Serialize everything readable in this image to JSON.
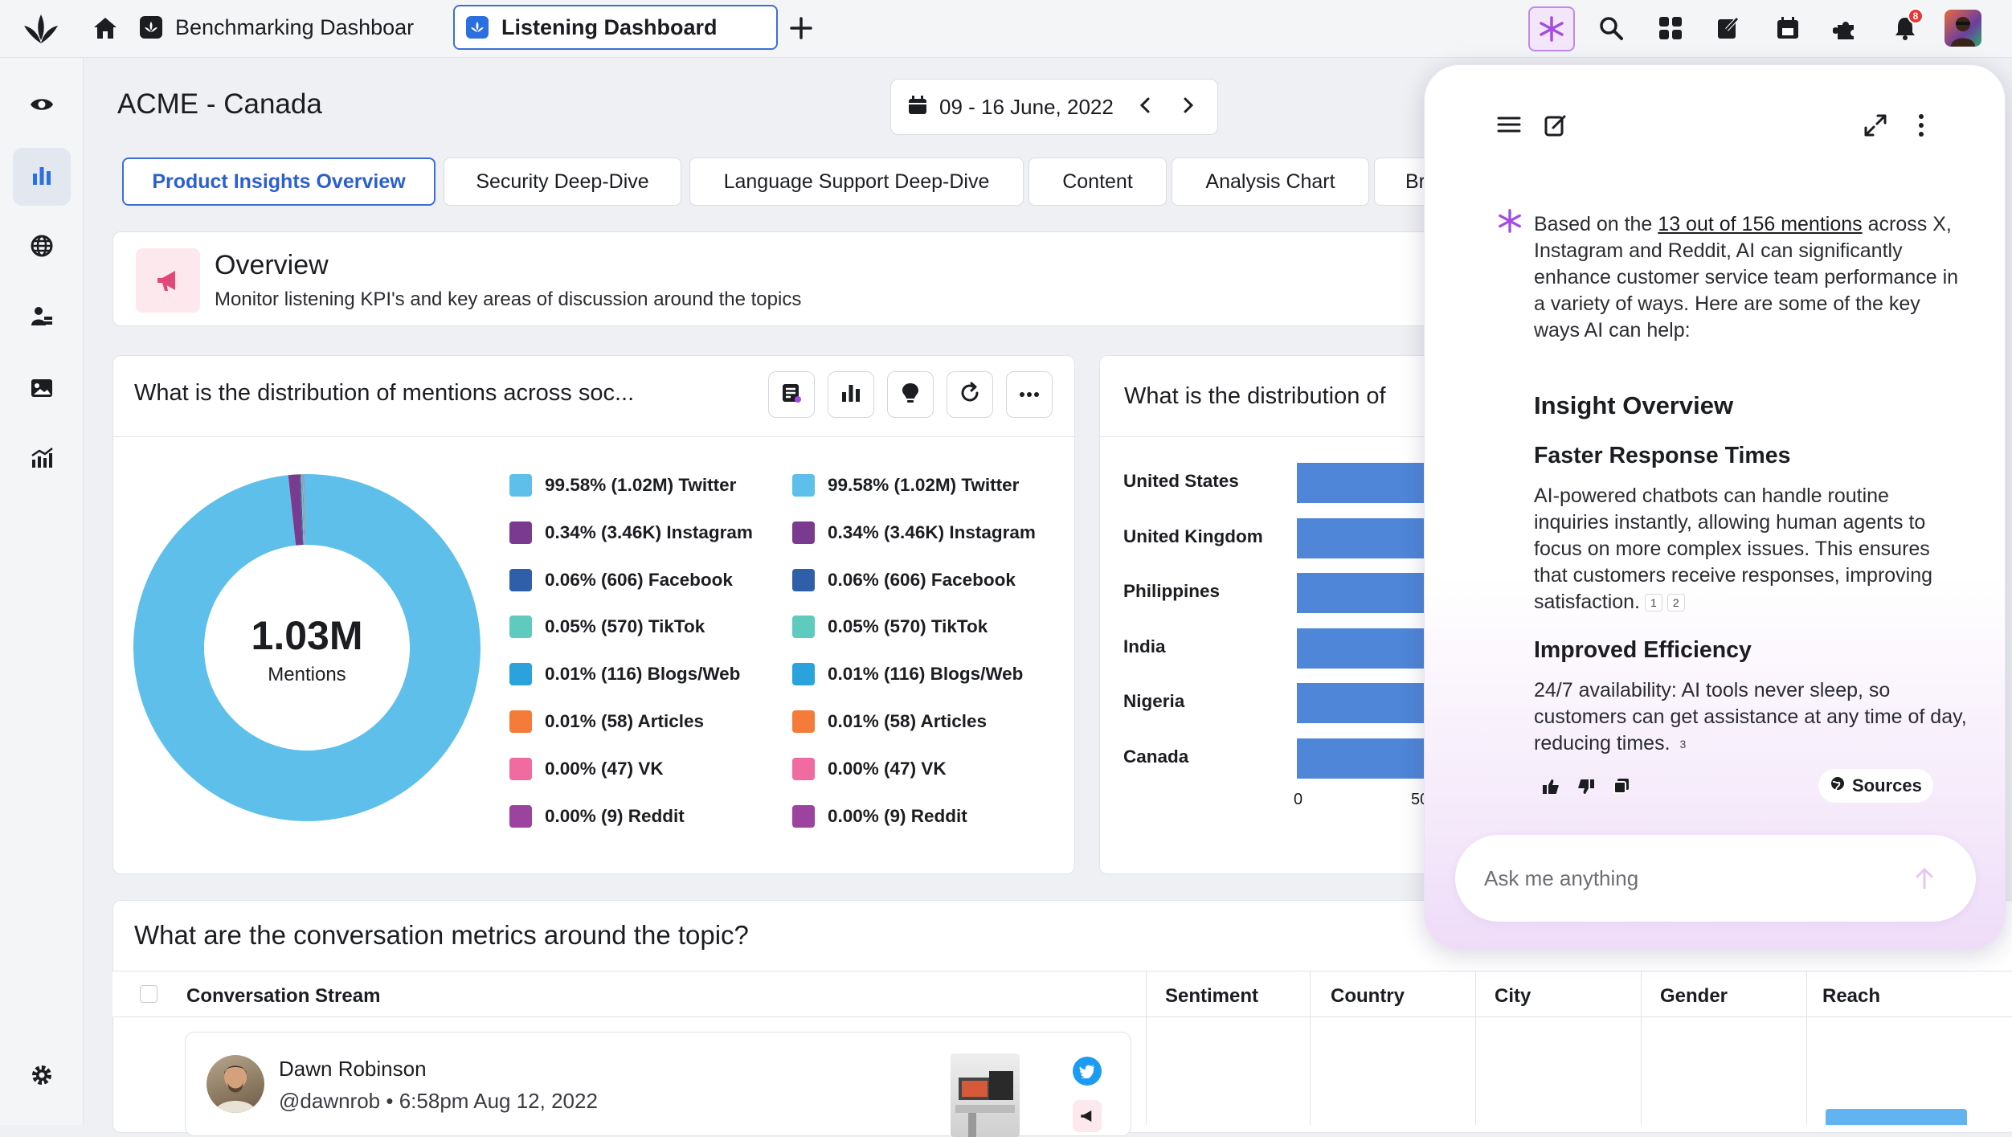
{
  "browser_tabs": [
    {
      "label": "Benchmarking Dashboar"
    },
    {
      "label": "Listening Dashboard"
    }
  ],
  "notification_count": "8",
  "page": {
    "title": "ACME - Canada",
    "date_range": "09 - 16 June, 2022"
  },
  "dashboard_tabs": [
    "Product Insights Overview",
    "Security Deep-Dive",
    "Language Support Deep-Dive",
    "Content",
    "Analysis Chart",
    "Br"
  ],
  "overview": {
    "title": "Overview",
    "subtitle": "Monitor listening KPI's and key areas of discussion around the topics"
  },
  "widget1": {
    "title": "What is the distribution of mentions across soc...",
    "center_value": "1.03M",
    "center_label": "Mentions"
  },
  "chart_data": [
    {
      "type": "pie",
      "categories": [
        "Twitter",
        "Instagram",
        "Facebook",
        "TikTok",
        "Blogs/Web",
        "Articles",
        "VK",
        "Reddit"
      ],
      "values": [
        99.58,
        0.34,
        0.06,
        0.05,
        0.01,
        0.01,
        0.0,
        0.0
      ],
      "counts": [
        "1.02M",
        "3.46K",
        "606",
        "570",
        "116",
        "58",
        "47",
        "9"
      ],
      "legend_labels": [
        "99.58% (1.02M) Twitter",
        "0.34% (3.46K) Instagram",
        "0.06% (606) Facebook",
        "0.05% (570) TikTok",
        "0.01% (116) Blogs/Web",
        "0.01% (58) Articles",
        "0.00% (47) VK",
        "0.00% (9) Reddit"
      ],
      "colors": [
        "#5ec0ea",
        "#7a3a8f",
        "#2f5fa8",
        "#5fcbbf",
        "#2aa3dc",
        "#f47b3a",
        "#f06ba0",
        "#9c43a0"
      ],
      "legend_placement": "right"
    },
    {
      "type": "bar",
      "orientation": "horizontal",
      "title": "What is the distribution of",
      "categories": [
        "United States",
        "United Kingdom",
        "Philippines",
        "India",
        "Nigeria",
        "Canada"
      ],
      "x_ticks": [
        "0",
        "50"
      ],
      "xlim": [
        0,
        50
      ],
      "note": "bars extend beyond visible area (cropped)"
    }
  ],
  "widget3": {
    "title": "What are the conversation metrics around the topic?",
    "columns": [
      "Conversation Stream",
      "Sentiment",
      "Country",
      "City",
      "Gender",
      "Reach"
    ],
    "post": {
      "author": "Dawn Robinson",
      "handle": "@dawnrob",
      "time": "6:58pm Aug 12, 2022",
      "separator": "•"
    }
  },
  "ai_panel": {
    "intro_prefix": "Based on the ",
    "intro_link": "13 out of 156 mentions",
    "intro_rest": "across X, Instagram and Reddit, AI can significantly enhance customer service team performance in a variety of ways. Here are some of the key ways AI can help:",
    "heading": "Insight Overview",
    "section1_title": "Faster Response Times",
    "section1_text": "AI-powered chatbots can handle routine inquiries instantly, allowing human agents to focus on more complex issues. This ensures that customers receive responses, improving satisfaction.",
    "section1_refs": [
      "1",
      "2"
    ],
    "section2_title": "Improved Efficiency",
    "section2_text": "24/7 availability: AI tools never sleep, so customers can get assistance at any time of day, reducing times.",
    "section2_refs": [
      "3"
    ],
    "sources_label": "Sources",
    "input_placeholder": "Ask me anything",
    "accent_color": "#a44be0"
  }
}
